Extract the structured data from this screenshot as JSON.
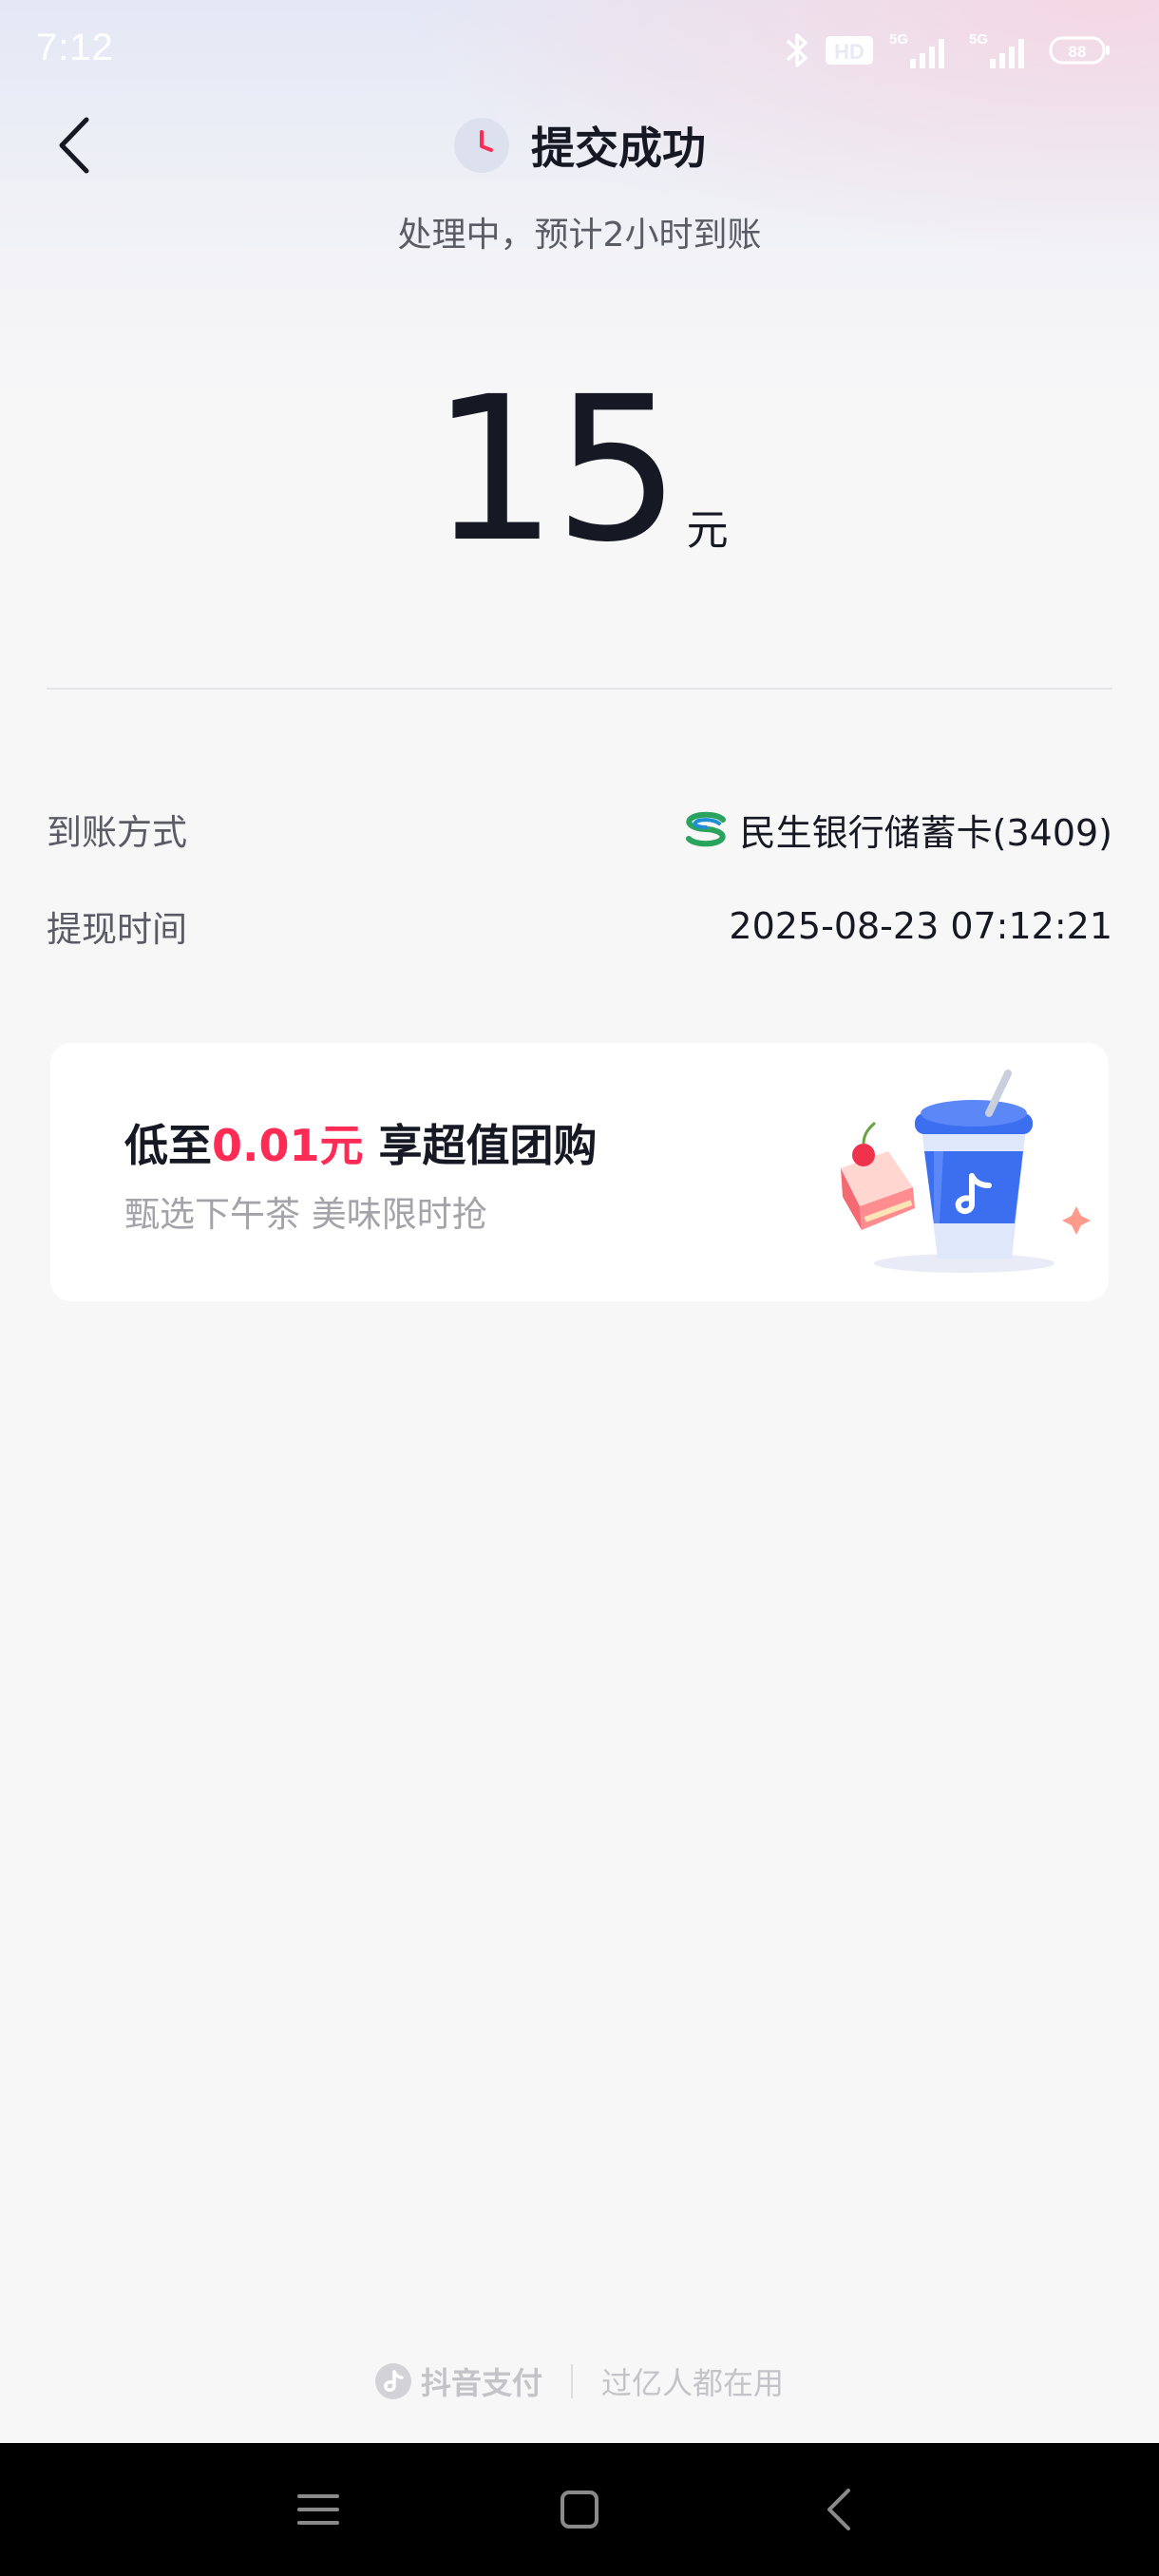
{
  "status_bar": {
    "time": "7:12",
    "network_1": "5G",
    "network_2": "5G",
    "hd_label": "HD",
    "battery": "88"
  },
  "header": {
    "back_icon": "chevron-left-icon",
    "status_icon": "clock-icon",
    "title": "提交成功",
    "subtitle": "处理中，预计2小时到账"
  },
  "amount": {
    "value": "15",
    "unit": "元"
  },
  "details": [
    {
      "label": "到账方式",
      "value": "民生银行储蓄卡(3409)",
      "icon": "minsheng-bank-icon"
    },
    {
      "label": "提现时间",
      "value": "2025-08-23 07:12:21"
    }
  ],
  "promo": {
    "title_prefix": "低至",
    "price": "0.01元",
    "title_suffix": " 享超值团购",
    "subtitle": "甄选下午茶 美味限时抢",
    "art": "cake-and-drink-cup-illustration"
  },
  "footer": {
    "brand": "抖音支付",
    "slogan": "过亿人都在用"
  },
  "colors": {
    "accent": "#fe2c55",
    "text_primary": "#161823",
    "text_secondary": "#5a5b64",
    "background": "#f7f7f8"
  }
}
